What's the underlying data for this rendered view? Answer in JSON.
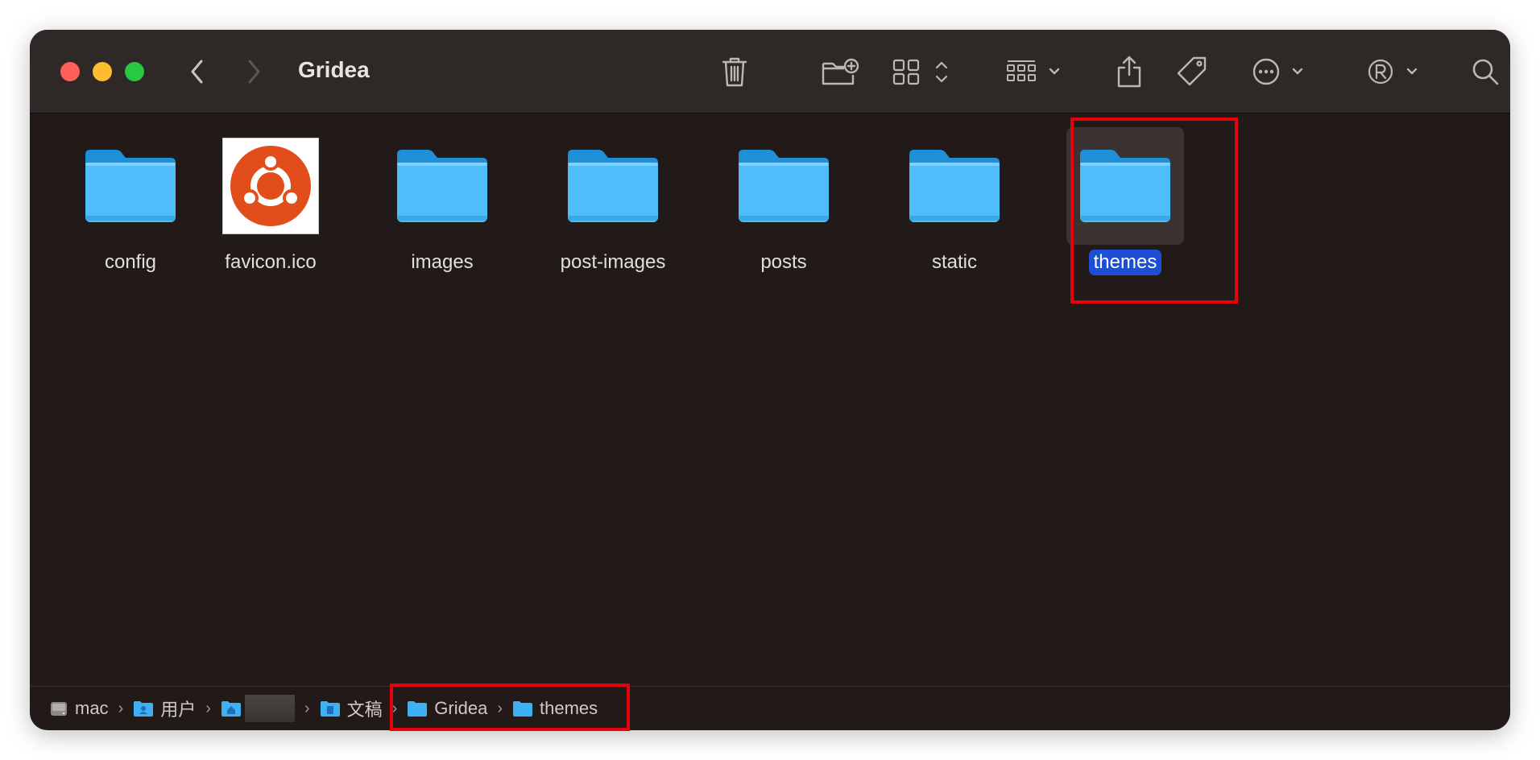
{
  "window": {
    "title": "Gridea",
    "traffic_lights": {
      "close": "#fe5f57",
      "minimize": "#febc2e",
      "zoom": "#28c840"
    }
  },
  "toolbar": {
    "back_icon": "chevron-left-icon",
    "forward_icon": "chevron-right-icon",
    "buttons": [
      "trash-icon",
      "new-folder-icon",
      "icon-view-icon",
      "group-by-icon",
      "share-icon",
      "tag-icon",
      "more-actions-icon",
      "registered-icon",
      "search-icon"
    ]
  },
  "files": [
    {
      "name": "config",
      "kind": "folder",
      "selected": false
    },
    {
      "name": "favicon.ico",
      "kind": "image",
      "selected": false
    },
    {
      "name": "images",
      "kind": "folder",
      "selected": false
    },
    {
      "name": "post-images",
      "kind": "folder",
      "selected": false
    },
    {
      "name": "posts",
      "kind": "folder",
      "selected": false
    },
    {
      "name": "static",
      "kind": "folder",
      "selected": false
    },
    {
      "name": "themes",
      "kind": "folder",
      "selected": true
    }
  ],
  "path_bar": {
    "items": [
      {
        "label": "mac",
        "icon": "hard-drive-icon"
      },
      {
        "label": "用户",
        "icon": "users-folder-icon"
      },
      {
        "label": "",
        "icon": "home-folder-icon",
        "redacted": true
      },
      {
        "label": "文稿",
        "icon": "documents-folder-icon"
      },
      {
        "label": "Gridea",
        "icon": "folder-icon"
      },
      {
        "label": "themes",
        "icon": "folder-icon"
      }
    ],
    "separator": "›"
  },
  "colors": {
    "window_bg": "#221a18",
    "toolbar_bg": "#2e2827",
    "selection": "#1d4fd6",
    "folder_blue": "#4fbdfa",
    "highlight_box": "#e8000b"
  }
}
